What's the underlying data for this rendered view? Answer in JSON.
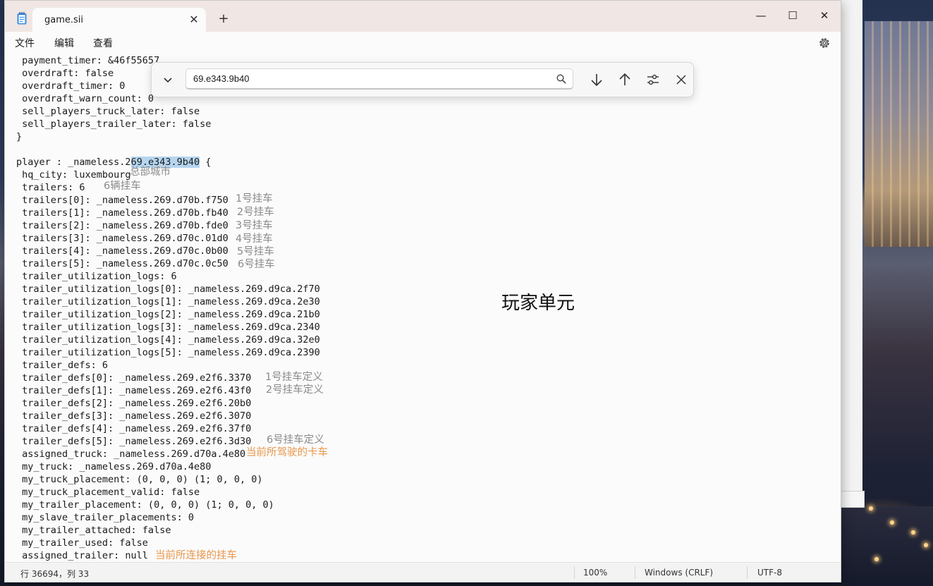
{
  "window": {
    "tab_title": "game.sii",
    "tab_close": "✕",
    "new_tab": "+",
    "minimize": "—",
    "maximize": "☐",
    "close": "✕"
  },
  "menu": {
    "file": "文件",
    "edit": "编辑",
    "view": "查看"
  },
  "find": {
    "query": "69.e343.9b40"
  },
  "editor": {
    "lines": [
      " payment_timer: &46f55657",
      " overdraft: false",
      " overdraft_timer: 0",
      " overdraft_warn_count: 0",
      " sell_players_truck_later: false",
      " sell_players_trailer_later: false",
      "}",
      "",
      "player : _nameless.2",
      " hq_city: luxembourg",
      " trailers: 6",
      " trailers[0]: _nameless.269.d70b.f750",
      " trailers[1]: _nameless.269.d70b.fb40",
      " trailers[2]: _nameless.269.d70b.fde0",
      " trailers[3]: _nameless.269.d70c.01d0",
      " trailers[4]: _nameless.269.d70c.0b00",
      " trailers[5]: _nameless.269.d70c.0c50",
      " trailer_utilization_logs: 6",
      " trailer_utilization_logs[0]: _nameless.269.d9ca.2f70",
      " trailer_utilization_logs[1]: _nameless.269.d9ca.2e30",
      " trailer_utilization_logs[2]: _nameless.269.d9ca.21b0",
      " trailer_utilization_logs[3]: _nameless.269.d9ca.2340",
      " trailer_utilization_logs[4]: _nameless.269.d9ca.32e0",
      " trailer_utilization_logs[5]: _nameless.269.d9ca.2390",
      " trailer_defs: 6",
      " trailer_defs[0]: _nameless.269.e2f6.3370",
      " trailer_defs[1]: _nameless.269.e2f6.43f0",
      " trailer_defs[2]: _nameless.269.e2f6.20b0",
      " trailer_defs[3]: _nameless.269.e2f6.3070",
      " trailer_defs[4]: _nameless.269.e2f6.37f0",
      " trailer_defs[5]: _nameless.269.e2f6.3d30",
      " assigned_truck: _nameless.269.d70a.4e80",
      " my_truck: _nameless.269.d70a.4e80",
      " my_truck_placement: (0, 0, 0) (1; 0, 0, 0)",
      " my_truck_placement_valid: false",
      " my_trailer_placement: (0, 0, 0) (1; 0, 0, 0)",
      " my_slave_trailer_placements: 0",
      " my_trailer_attached: false",
      " my_trailer_used: false",
      " assigned_trailer: null"
    ],
    "player_highlight": "69.e343.9b40",
    "player_suffix": " {",
    "annotations": {
      "hq_city": "总部城市",
      "trailers_count": "6辆挂车",
      "trailer0": "1号挂车",
      "trailer1": "2号挂车",
      "trailer2": "3号挂车",
      "trailer3": "4号挂车",
      "trailer4": "5号挂车",
      "trailer5": "6号挂车",
      "def0": "1号挂车定义",
      "def1": "2号挂车定义",
      "def5": "6号挂车定义",
      "assigned_truck": "当前所驾驶的卡车",
      "assigned_trailer": "当前所连接的挂车",
      "player_unit": "玩家单元"
    }
  },
  "status": {
    "position": "行 36694，列 33",
    "zoom": "100%",
    "line_ending": "Windows (CRLF)",
    "encoding": "UTF-8"
  }
}
